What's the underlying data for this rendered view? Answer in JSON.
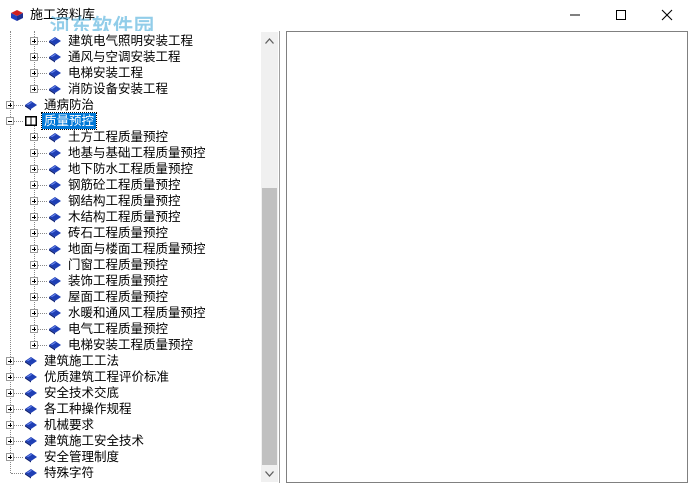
{
  "window": {
    "title": "施工资料库",
    "watermark": "河东软件园",
    "watermark_sub": "n"
  },
  "tree": {
    "items": [
      {
        "label": "建筑电气照明安装工程",
        "level": 1,
        "expander": "plus"
      },
      {
        "label": "通风与空调安装工程",
        "level": 1,
        "expander": "plus"
      },
      {
        "label": "电梯安装工程",
        "level": 1,
        "expander": "plus"
      },
      {
        "label": "消防设备安装工程",
        "level": 1,
        "expander": "plus"
      },
      {
        "label": "通病防治",
        "level": 0,
        "expander": "plus"
      },
      {
        "label": "质量预控",
        "level": 0,
        "expander": "minus",
        "selected": true,
        "open_book": true
      },
      {
        "label": "土方工程质量预控",
        "level": 1,
        "expander": "plus"
      },
      {
        "label": "地基与基础工程质量预控",
        "level": 1,
        "expander": "plus"
      },
      {
        "label": "地下防水工程质量预控",
        "level": 1,
        "expander": "plus"
      },
      {
        "label": "钢筋砼工程质量预控",
        "level": 1,
        "expander": "plus"
      },
      {
        "label": "钢结构工程质量预控",
        "level": 1,
        "expander": "plus"
      },
      {
        "label": "木结构工程质量预控",
        "level": 1,
        "expander": "plus"
      },
      {
        "label": "砖石工程质量预控",
        "level": 1,
        "expander": "plus"
      },
      {
        "label": "地面与楼面工程质量预控",
        "level": 1,
        "expander": "plus"
      },
      {
        "label": "门窗工程质量预控",
        "level": 1,
        "expander": "plus"
      },
      {
        "label": "装饰工程质量预控",
        "level": 1,
        "expander": "plus"
      },
      {
        "label": "屋面工程质量预控",
        "level": 1,
        "expander": "plus"
      },
      {
        "label": "水暖和通风工程质量预控",
        "level": 1,
        "expander": "plus"
      },
      {
        "label": "电气工程质量预控",
        "level": 1,
        "expander": "plus"
      },
      {
        "label": "电梯安装工程质量预控",
        "level": 1,
        "expander": "plus"
      },
      {
        "label": "建筑施工工法",
        "level": 0,
        "expander": "plus"
      },
      {
        "label": "优质建筑工程评价标准",
        "level": 0,
        "expander": "plus"
      },
      {
        "label": "安全技术交底",
        "level": 0,
        "expander": "plus"
      },
      {
        "label": "各工种操作规程",
        "level": 0,
        "expander": "plus"
      },
      {
        "label": "机械要求",
        "level": 0,
        "expander": "plus"
      },
      {
        "label": "建筑施工安全技术",
        "level": 0,
        "expander": "plus"
      },
      {
        "label": "安全管理制度",
        "level": 0,
        "expander": "plus"
      },
      {
        "label": "特殊字符",
        "level": 0,
        "expander": "none"
      }
    ]
  },
  "colors": {
    "selection": "#0078d7",
    "book_blue": "#1f3fb5"
  },
  "icons": {
    "app": "book-icon",
    "minimize": "minimize-icon",
    "maximize": "maximize-icon",
    "close": "close-icon"
  }
}
